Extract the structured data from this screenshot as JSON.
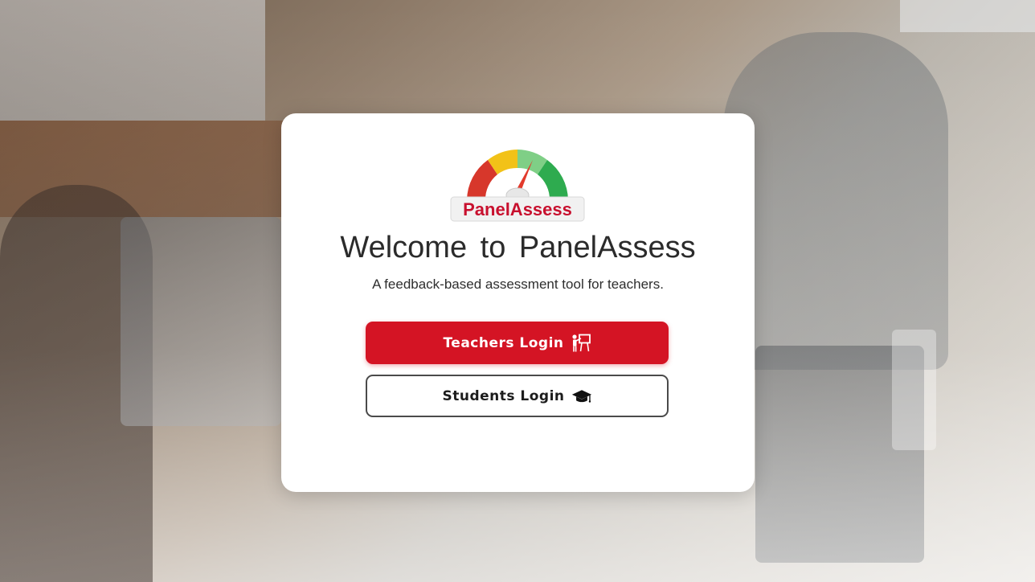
{
  "logo": {
    "text": "PanelAssess",
    "icon": "gauge-icon",
    "colors": {
      "red": "#d7372b",
      "yellow": "#f2c218",
      "lightgreen": "#7fcf86",
      "green": "#2eab4f",
      "text": "#c8102e"
    }
  },
  "title": "Welcome  to  PanelAssess",
  "subtitle": "A feedback-based assessment tool for teachers.",
  "buttons": {
    "teachers": {
      "label": "Teachers Login",
      "icon": "teacher-board-icon",
      "color": "#d41424"
    },
    "students": {
      "label": "Students Login",
      "icon": "graduation-cap-icon"
    }
  }
}
